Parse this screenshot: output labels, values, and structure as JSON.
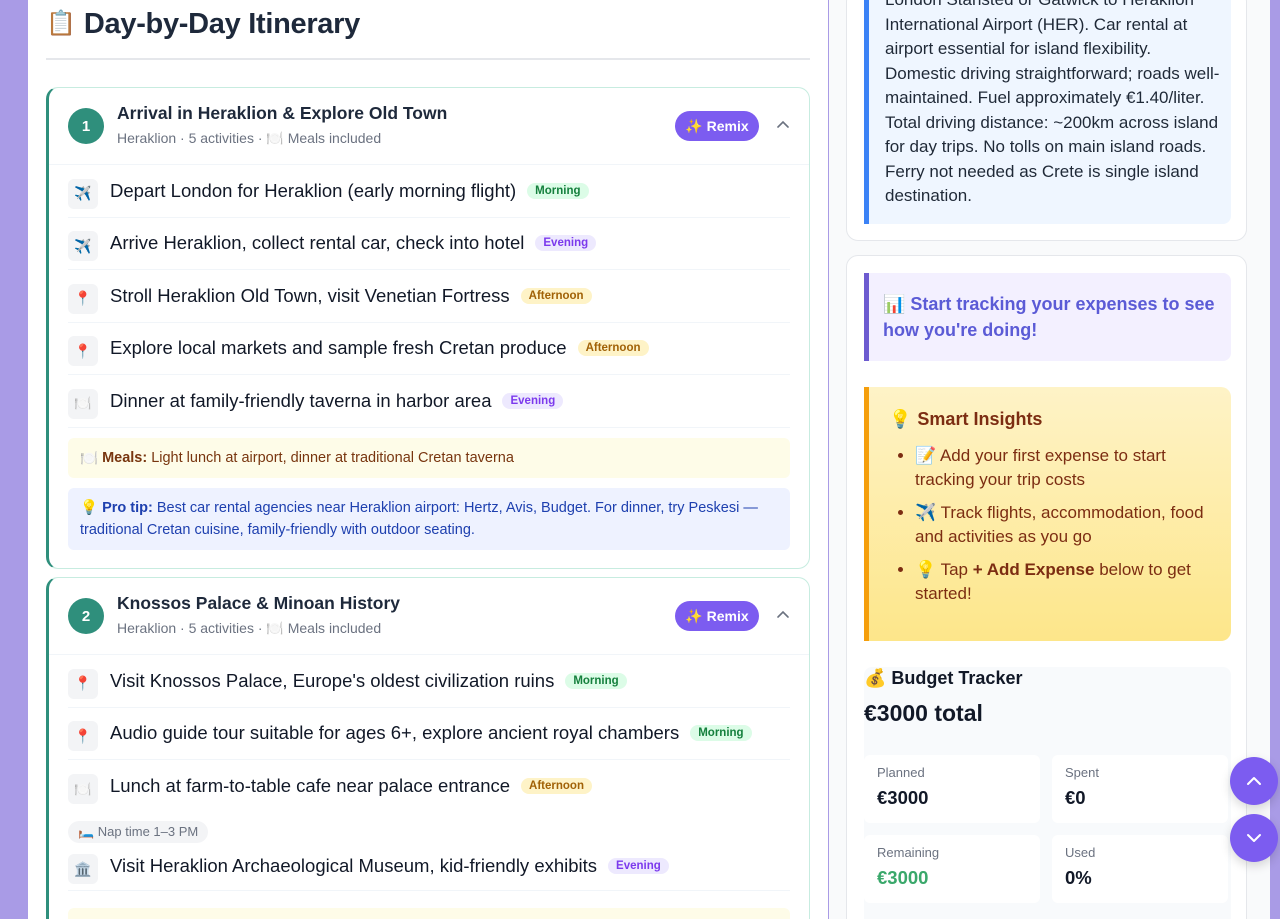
{
  "itinerary": {
    "icon": "📋",
    "title": "Day-by-Day Itinerary",
    "days": [
      {
        "number": "1",
        "title": "Arrival in Heraklion & Explore Old Town",
        "location": "Heraklion",
        "activities_count": "· 5 activities",
        "meals_label": "· 🍽️ Meals included",
        "remix_label": "✨ Remix",
        "activities": [
          {
            "icon": "✈️",
            "text": "Depart London for Heraklion (early morning flight)",
            "tag": "Morning"
          },
          {
            "icon": "✈️",
            "text": "Arrive Heraklion, collect rental car, check into hotel",
            "tag": "Evening"
          },
          {
            "icon": "📍",
            "text": "Stroll Heraklion Old Town, visit Venetian Fortress",
            "tag": "Afternoon"
          },
          {
            "icon": "📍",
            "text": "Explore local markets and sample fresh Cretan produce",
            "tag": "Afternoon"
          },
          {
            "icon": "🍽️",
            "text": "Dinner at family-friendly taverna in harbor area",
            "tag": "Evening"
          }
        ],
        "meals": {
          "icon": "🍽️",
          "label": "Meals:",
          "text": "Light lunch at airport, dinner at traditional Cretan taverna"
        },
        "tip": {
          "icon": "💡",
          "label": "Pro tip:",
          "text": "Best car rental agencies near Heraklion airport: Hertz, Avis, Budget. For dinner, try Peskesi — traditional Cretan cuisine, family-friendly with outdoor seating."
        }
      },
      {
        "number": "2",
        "title": "Knossos Palace & Minoan History",
        "location": "Heraklion",
        "activities_count": "· 5 activities",
        "meals_label": "· 🍽️ Meals included",
        "remix_label": "✨ Remix",
        "activities": [
          {
            "icon": "📍",
            "text": "Visit Knossos Palace, Europe's oldest civilization ruins",
            "tag": "Morning"
          },
          {
            "icon": "📍",
            "text": "Audio guide tour suitable for ages 6+, explore ancient royal chambers",
            "tag": "Morning"
          },
          {
            "icon": "🍽️",
            "text": "Lunch at farm-to-table cafe near palace entrance",
            "tag": "Afternoon"
          }
        ],
        "nap": "🛏️ Nap time 1–3 PM",
        "activities_after_nap": [
          {
            "icon": "🏛️",
            "text": "Visit Heraklion Archaeological Museum, kid-friendly exhibits",
            "tag": "Evening"
          }
        ]
      }
    ]
  },
  "transport": {
    "text": "London Stansted or Gatwick to Heraklion International Airport (HER). Car rental at airport essential for island flexibility. Domestic driving straightforward; roads well-maintained. Fuel approximately €1.40/liter. Total driving distance: ~200km across island for day trips. No tolls on main island roads. Ferry not needed as Crete is single island destination."
  },
  "expenses": {
    "prompt": "📊 Start tracking your expenses to see how you're doing!",
    "insights": {
      "icon": "💡",
      "title": "Smart Insights",
      "items": [
        {
          "icon": "📝",
          "text": "Add your first expense to start tracking your trip costs"
        },
        {
          "icon": "✈️",
          "text": "Track flights, accommodation, food and activities as you go"
        }
      ],
      "last_item": {
        "icon": "💡",
        "pre": "Tap",
        "bold": "+ Add Expense",
        "post": "below to get started!"
      }
    },
    "budget": {
      "icon": "💰",
      "title": "Budget Tracker",
      "total": "€3000 total",
      "planned_label": "Planned",
      "planned_value": "€3000",
      "spent_label": "Spent",
      "spent_value": "€0",
      "remaining_label": "Remaining",
      "remaining_value": "€3000",
      "used_label": "Used",
      "used_value": "0%"
    }
  },
  "colors": {
    "accent": "#7c5cf0",
    "day_teal": "#2f8f7c",
    "morning": "#15803d",
    "evening": "#7c3aed",
    "afternoon": "#a16207"
  }
}
